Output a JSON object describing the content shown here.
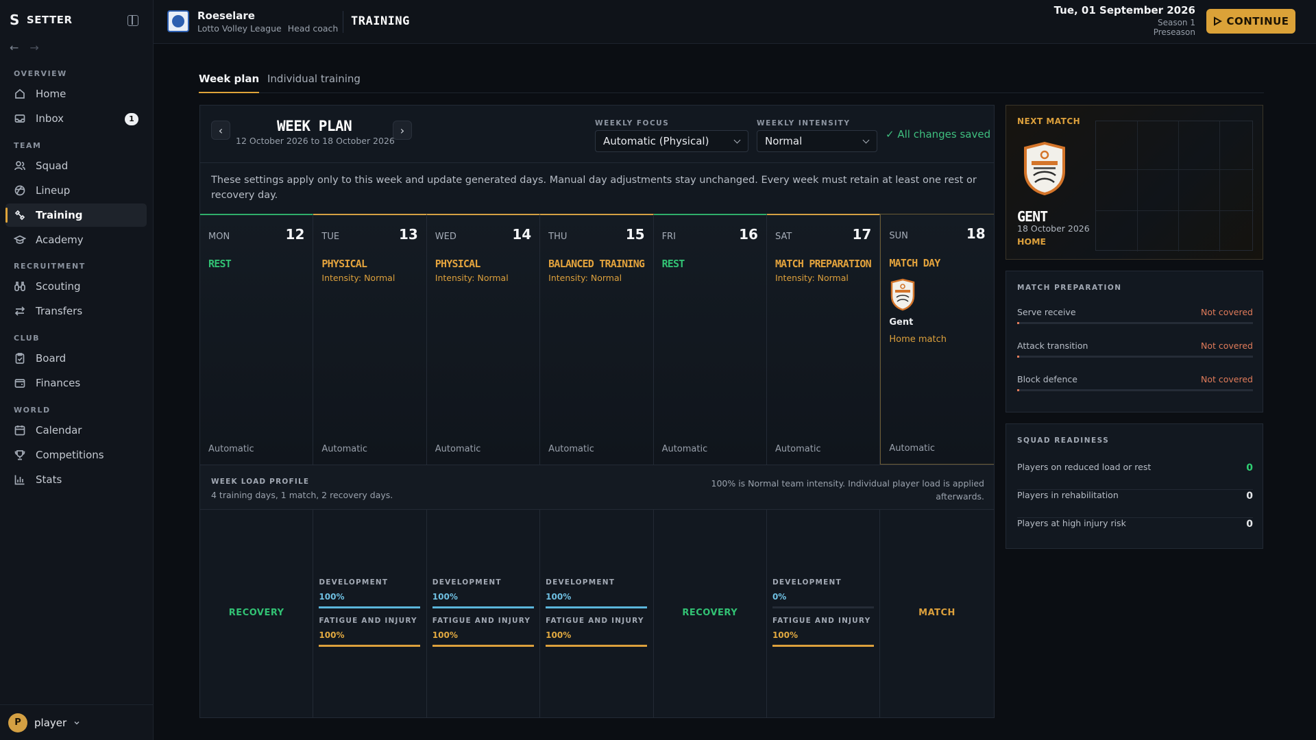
{
  "app": {
    "name": "SETTER",
    "logo_letter": "S"
  },
  "sidebar": {
    "sections": [
      {
        "label": "OVERVIEW",
        "items": [
          {
            "label": "Home",
            "icon": "home-icon"
          },
          {
            "label": "Inbox",
            "icon": "inbox-icon",
            "badge": "1"
          }
        ]
      },
      {
        "label": "TEAM",
        "items": [
          {
            "label": "Squad",
            "icon": "squad-icon"
          },
          {
            "label": "Lineup",
            "icon": "lineup-icon"
          },
          {
            "label": "Training",
            "icon": "training-icon",
            "active": true
          },
          {
            "label": "Academy",
            "icon": "academy-icon"
          }
        ]
      },
      {
        "label": "RECRUITMENT",
        "items": [
          {
            "label": "Scouting",
            "icon": "scouting-icon"
          },
          {
            "label": "Transfers",
            "icon": "transfers-icon"
          }
        ]
      },
      {
        "label": "CLUB",
        "items": [
          {
            "label": "Board",
            "icon": "board-icon"
          },
          {
            "label": "Finances",
            "icon": "finances-icon"
          }
        ]
      },
      {
        "label": "WORLD",
        "items": [
          {
            "label": "Calendar",
            "icon": "calendar-icon"
          },
          {
            "label": "Competitions",
            "icon": "trophy-icon"
          },
          {
            "label": "Stats",
            "icon": "stats-icon"
          }
        ]
      }
    ],
    "user": {
      "initial": "P",
      "name": "player"
    }
  },
  "header": {
    "club": "Roeselare",
    "league": "Lotto Volley League",
    "role": "Head coach",
    "page_title": "TRAINING",
    "date": "Tue, 01 September 2026",
    "season": "Season 1",
    "phase": "Preseason",
    "continue_label": "CONTINUE"
  },
  "tabs": {
    "week_plan": "Week plan",
    "individual": "Individual training"
  },
  "week": {
    "title": "WEEK PLAN",
    "range": "12 October 2026 to 18 October 2026",
    "focus_label": "WEEKLY FOCUS",
    "focus_value": "Automatic (Physical)",
    "intensity_label": "WEEKLY INTENSITY",
    "intensity_value": "Normal",
    "saved": "✓ All changes saved",
    "note": "These settings apply only to this week and update generated days. Manual day adjustments stay unchanged. Every week must retain at least one rest or recovery day.",
    "days": [
      {
        "dow": "MON",
        "num": "12",
        "type": "REST",
        "intensity": "",
        "mode": "Automatic"
      },
      {
        "dow": "TUE",
        "num": "13",
        "type": "PHYSICAL",
        "intensity": "Intensity: Normal",
        "mode": "Automatic"
      },
      {
        "dow": "WED",
        "num": "14",
        "type": "PHYSICAL",
        "intensity": "Intensity: Normal",
        "mode": "Automatic"
      },
      {
        "dow": "THU",
        "num": "15",
        "type": "BALANCED TRAINING",
        "intensity": "Intensity: Normal",
        "mode": "Automatic"
      },
      {
        "dow": "FRI",
        "num": "16",
        "type": "REST",
        "intensity": "",
        "mode": "Automatic"
      },
      {
        "dow": "SAT",
        "num": "17",
        "type": "MATCH PREPARATION",
        "intensity": "Intensity: Normal",
        "mode": "Automatic"
      },
      {
        "dow": "SUN",
        "num": "18",
        "type": "MATCH DAY",
        "intensity": "",
        "mode": "Automatic",
        "opponent": "Gent",
        "venue": "Home match"
      }
    ]
  },
  "load": {
    "title": "WEEK LOAD PROFILE",
    "summary": "4 training days, 1 match, 2 recovery days.",
    "note": "100% is Normal team intensity. Individual player load is applied afterwards.",
    "dev_label": "DEVELOPMENT",
    "fatigue_label": "FATIGUE AND INJURY",
    "recovery_label": "RECOVERY",
    "match_label": "MATCH",
    "columns": [
      {
        "kind": "recovery"
      },
      {
        "kind": "training",
        "development": "100%",
        "fatigue": "100%",
        "development_fraction": 1.0,
        "fatigue_fraction": 1.0
      },
      {
        "kind": "training",
        "development": "100%",
        "fatigue": "100%",
        "development_fraction": 1.0,
        "fatigue_fraction": 1.0
      },
      {
        "kind": "training",
        "development": "100%",
        "fatigue": "100%",
        "development_fraction": 1.0,
        "fatigue_fraction": 1.0
      },
      {
        "kind": "recovery"
      },
      {
        "kind": "training",
        "development": "0%",
        "fatigue": "100%",
        "development_fraction": 0.0,
        "fatigue_fraction": 1.0
      },
      {
        "kind": "match"
      }
    ]
  },
  "next_match": {
    "label": "NEXT MATCH",
    "team": "GENT",
    "date": "18 October 2026",
    "venue": "HOME"
  },
  "match_prep": {
    "title": "MATCH PREPARATION",
    "items": [
      {
        "label": "Serve receive",
        "status": "Not covered"
      },
      {
        "label": "Attack transition",
        "status": "Not covered"
      },
      {
        "label": "Block defence",
        "status": "Not covered"
      }
    ]
  },
  "readiness": {
    "title": "SQUAD READINESS",
    "items": [
      {
        "label": "Players on reduced load or rest",
        "value": "0"
      },
      {
        "label": "Players in rehabilitation",
        "value": "0"
      },
      {
        "label": "Players at high injury risk",
        "value": "0"
      }
    ]
  },
  "colors": {
    "accent": "#dca03c",
    "rest": "#32c274",
    "development_bar": "#5bb6dc",
    "fatigue_bar": "#dca03c",
    "warning": "#e07b5a"
  }
}
